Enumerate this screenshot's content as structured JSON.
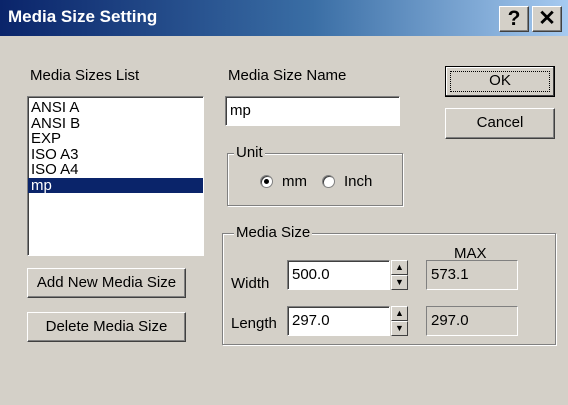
{
  "window": {
    "title": "Media Size Setting",
    "help_glyph": "?",
    "close_glyph": "✕"
  },
  "labels": {
    "media_sizes_list": "Media Sizes List",
    "media_size_name": "Media Size Name",
    "width": "Width",
    "length": "Length",
    "max": "MAX"
  },
  "media_list": {
    "items": [
      "ANSI A",
      "ANSI B",
      "EXP",
      "ISO A3",
      "ISO A4",
      "mp"
    ],
    "selected": "mp"
  },
  "name_field": {
    "value": "mp"
  },
  "buttons": {
    "ok": "OK",
    "cancel": "Cancel",
    "add": "Add New Media Size",
    "delete": "Delete Media Size"
  },
  "unit": {
    "legend": "Unit",
    "options": [
      "mm",
      "Inch"
    ],
    "selected": "mm"
  },
  "media_size": {
    "legend": "Media Size",
    "width_value": "500.0",
    "length_value": "297.0",
    "max_width": "573.1",
    "max_length": "297.0"
  },
  "colors": {
    "titlebar_start": "#0a246a",
    "titlebar_end": "#a6caf0",
    "selection": "#0a246a",
    "face": "#d4d0c8"
  }
}
